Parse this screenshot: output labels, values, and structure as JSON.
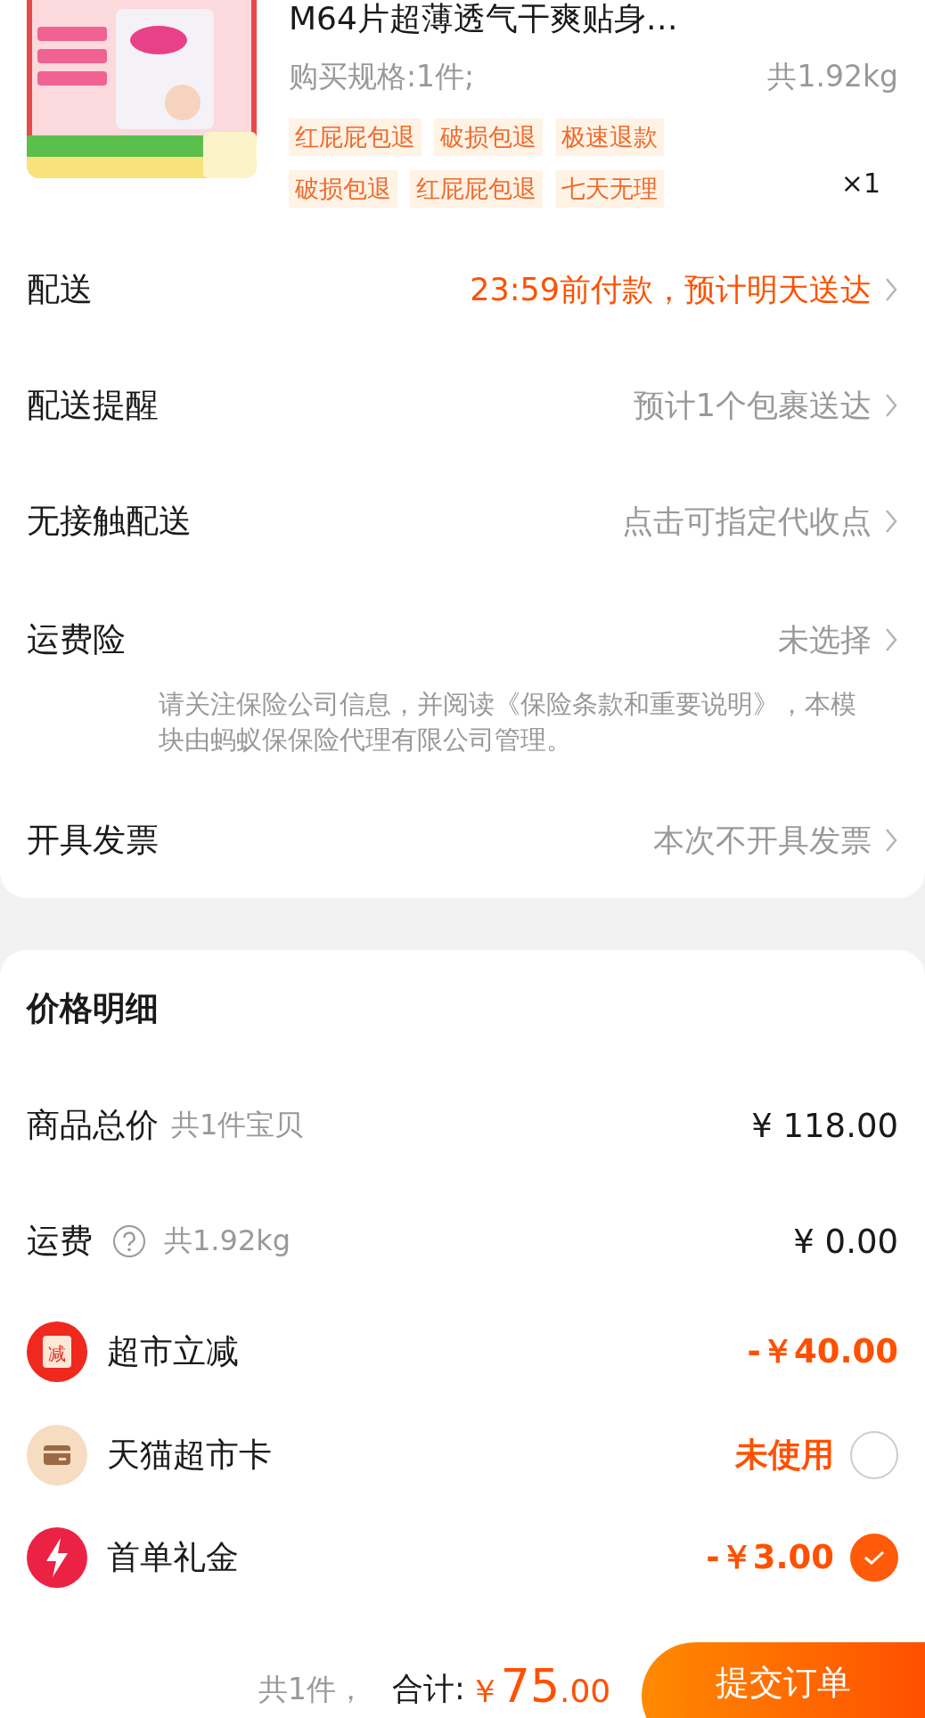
{
  "product": {
    "title": "M64片超薄透气干爽贴身…",
    "spec": "购买规格:1件;",
    "weight": "共1.92kg",
    "tags": [
      "红屁屁包退",
      "破损包退",
      "极速退款",
      "破损包退",
      "红屁屁包退",
      "七天无理"
    ],
    "quantity": "×1"
  },
  "delivery_rows": [
    {
      "label": "配送",
      "value": "23:59前付款，预计明天送达",
      "highlight": true
    },
    {
      "label": "配送提醒",
      "value": "预计1个包裹送达",
      "highlight": false
    },
    {
      "label": "无接触配送",
      "value": "点击可指定代收点",
      "highlight": false
    },
    {
      "label": "运费险",
      "value": "未选择",
      "highlight": false,
      "note": "请关注保险公司信息，并阅读《保险条款和重要说明》，本模块由蚂蚁保保险代理有限公司管理。"
    },
    {
      "label": "开具发票",
      "value": "本次不开具发票",
      "highlight": false
    }
  ],
  "price_details": {
    "title": "价格明细",
    "rows": [
      {
        "kind": "plain",
        "label": "商品总价",
        "sub": "共1件宝贝",
        "amount": "¥ 118.00"
      },
      {
        "kind": "help",
        "label": "运费",
        "sub": "共1.92kg",
        "amount": "¥ 0.00"
      },
      {
        "kind": "discount",
        "badge_text": "减",
        "label": "超市立减",
        "amount": "-￥40.00"
      },
      {
        "kind": "option",
        "label": "天猫超市卡",
        "amount": "未使用",
        "checked": false
      },
      {
        "kind": "option",
        "label": "首单礼金",
        "amount": "-￥3.00",
        "checked": true
      }
    ]
  },
  "footer": {
    "count": "共1件，",
    "total_label": "合计:",
    "total": "￥75.00",
    "submit": "提交订单"
  }
}
